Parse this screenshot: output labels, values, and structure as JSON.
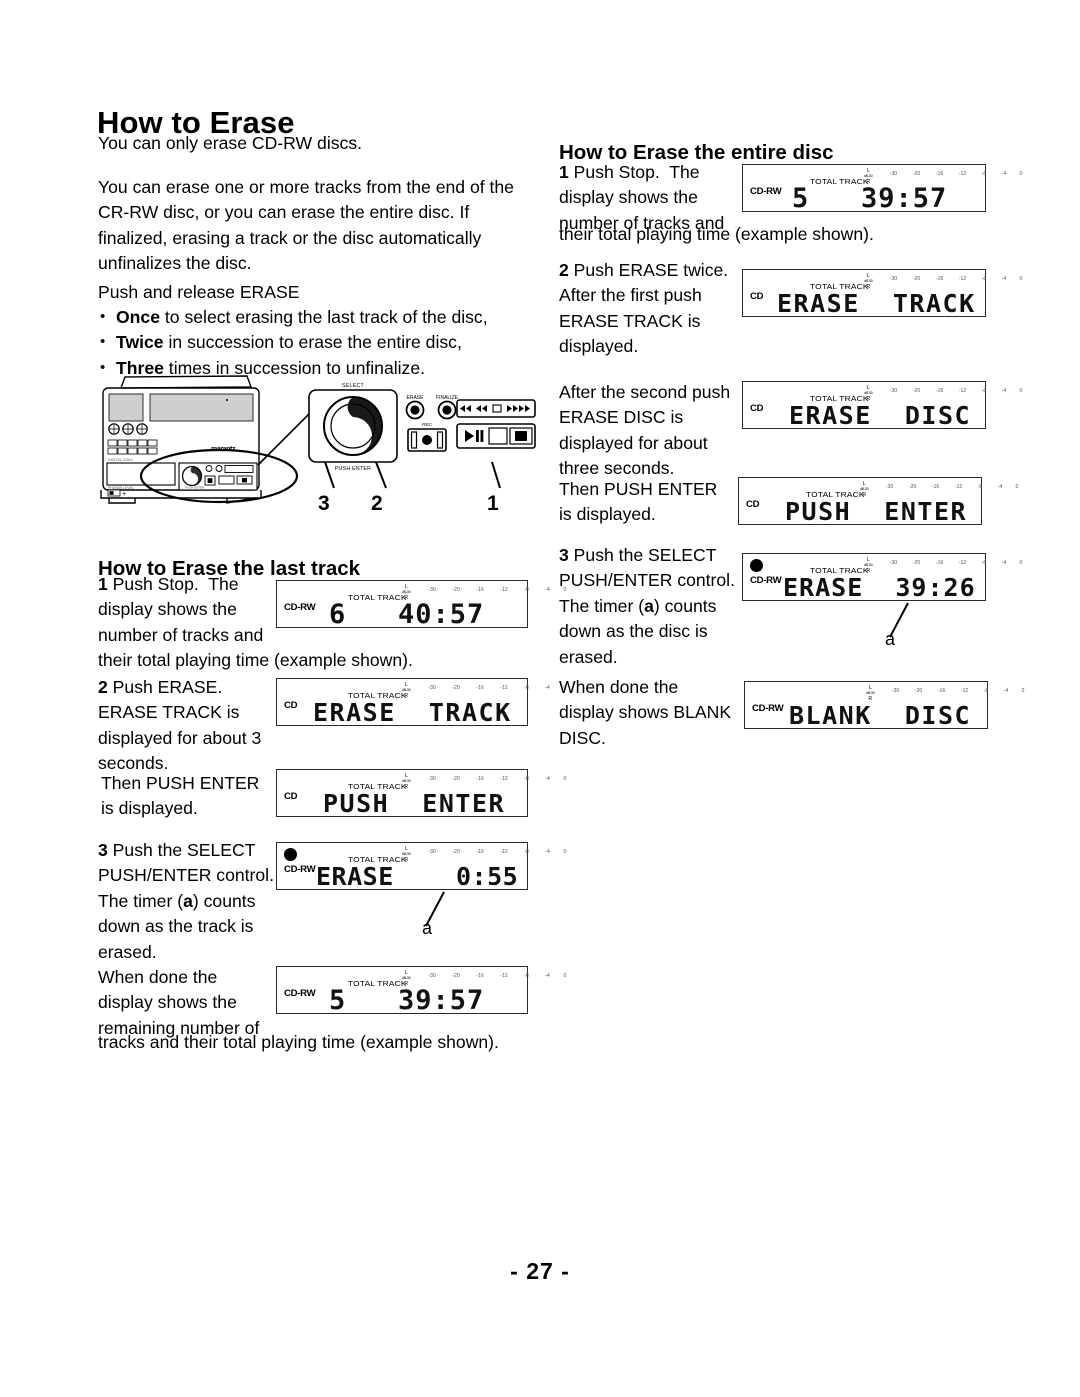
{
  "page": {
    "number_label": "- 27 -",
    "title": "How to Erase"
  },
  "intro": {
    "line1": "You can only erase CD-RW discs.",
    "paragraph": "You can erase one or more tracks from the end of the\nCR-RW disc, or you can erase the entire disc. If\nfinalized, erasing a track or the disc automatically\nunfinalizes the disc.",
    "push_release": "Push and release ERASE",
    "bullets": [
      {
        "bold": "Once",
        "rest": " to select erasing the last track of the disc,"
      },
      {
        "bold": "Twice",
        "rest": " in succession to erase the entire disc,"
      },
      {
        "bold": "Three",
        "rest": " times in succession to unfinalize."
      }
    ]
  },
  "illustration": {
    "brand": "marantz",
    "callout_select": "SELECT",
    "callout_push_enter": "PUSH ENTER",
    "callout_erase": "ERASE",
    "callout_finalize": "FINALIZE",
    "callout_rec": "REC",
    "numbers": [
      "3",
      "2",
      "1"
    ]
  },
  "last_track": {
    "heading": "How to Erase the last track",
    "step1_num": "1",
    "step1_text": " Push Stop.  The\ndisplay shows the\nnumber of tracks and",
    "step1_wide": "their total playing time (example shown).",
    "step2_num": "2",
    "step2_text": " Push ERASE.\nERASE TRACK is\ndisplayed for about 3\nseconds.",
    "then_push_enter": "Then PUSH ENTER\nis displayed.",
    "step3_num": "3",
    "step3_text": " Push the SELECT\nPUSH/ENTER control.\nThe timer (",
    "step3_a": "a",
    "step3_text2": ") counts\ndown as the track is\nerased.",
    "done_text": "When done the\ndisplay shows the\nremaining number of",
    "done_wide": "tracks and their total playing time (example shown).",
    "a_label": "a"
  },
  "entire_disc": {
    "heading": "How to Erase the entire disc",
    "step1_num": "1",
    "step1_text": " Push Stop.  The\ndisplay shows the\nnumber of tracks and",
    "step1_wide": "their total playing time (example shown).",
    "step2_num": "2",
    "step2_text": " Push ERASE twice.\nAfter the first push\nERASE TRACK is\ndisplayed.",
    "second_push": "After the second push\nERASE DISC is\ndisplayed for about\nthree seconds.",
    "then_push_enter": "Then PUSH ENTER\nis displayed.",
    "step3_num": "3",
    "step3_text": " Push the SELECT\nPUSH/ENTER control.\nThe timer (",
    "step3_a": "a",
    "step3_text2": ") counts\ndown as the disc is\nerased.",
    "done_text": "When done the\ndisplay shows BLANK\nDISC.",
    "a_label": "a"
  },
  "displays": {
    "common": {
      "total_track_label": "TOTAL TRACK",
      "lr_top": "L",
      "lr_db": "dB-50",
      "lr_bottom": "R",
      "scale": [
        "-30",
        "-20",
        "-16",
        "-12",
        "-8",
        "-4",
        "0"
      ]
    },
    "lt_1": {
      "mode": "CD-RW",
      "text": "6   40:57",
      "has_total_track": true,
      "rec": false
    },
    "lt_2": {
      "mode": "CD",
      "text": "ERASE  TRACK",
      "has_total_track": true,
      "rec": false
    },
    "lt_3": {
      "mode": "CD",
      "text": "PUSH  ENTER",
      "has_total_track": true,
      "rec": false
    },
    "lt_4": {
      "mode": "CD-RW",
      "text": "ERASE    0:55",
      "has_total_track": true,
      "rec": true
    },
    "lt_5": {
      "mode": "CD-RW",
      "text": "5   39:57",
      "has_total_track": true,
      "rec": false
    },
    "ed_1": {
      "mode": "CD-RW",
      "text": "5   39:57",
      "has_total_track": true,
      "rec": false
    },
    "ed_2": {
      "mode": "CD",
      "text": "ERASE  TRACK",
      "has_total_track": true,
      "rec": false
    },
    "ed_3": {
      "mode": "CD",
      "text": "ERASE  DISC",
      "has_total_track": true,
      "rec": false
    },
    "ed_4": {
      "mode": "CD",
      "text": "PUSH  ENTER",
      "has_total_track": true,
      "rec": false
    },
    "ed_5": {
      "mode": "CD-RW",
      "text": "ERASE  39:26",
      "has_total_track": true,
      "rec": true
    },
    "ed_6": {
      "mode": "CD-RW",
      "text": "BLANK  DISC",
      "has_total_track": false,
      "rec": false
    }
  }
}
